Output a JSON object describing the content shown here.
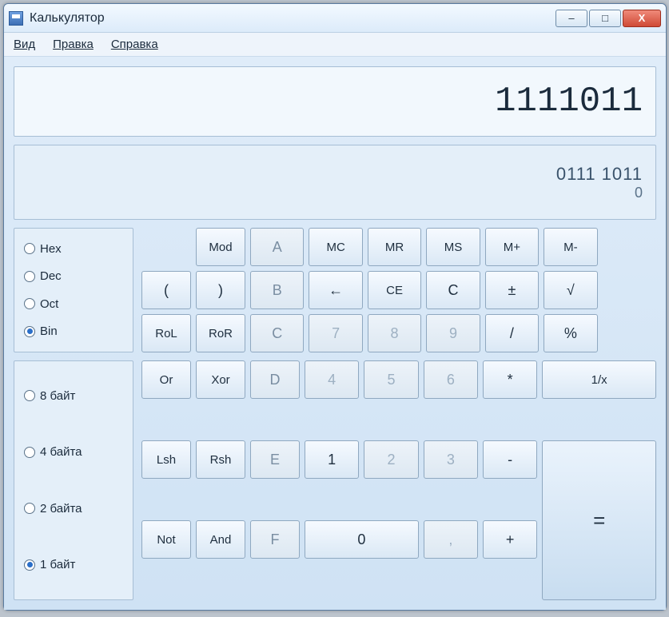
{
  "title": "Калькулятор",
  "menu": {
    "view": "Вид",
    "edit": "Правка",
    "help": "Справка"
  },
  "display": "1111011",
  "bits": {
    "row1": "0111  1011",
    "row2": "0"
  },
  "base_radios": [
    {
      "label": "Hex",
      "checked": false
    },
    {
      "label": "Dec",
      "checked": false
    },
    {
      "label": "Oct",
      "checked": false
    },
    {
      "label": "Bin",
      "checked": true
    }
  ],
  "word_radios": [
    {
      "label": "8 байт",
      "checked": false
    },
    {
      "label": "4 байта",
      "checked": false
    },
    {
      "label": "2 байта",
      "checked": false
    },
    {
      "label": "1 байт",
      "checked": true
    }
  ],
  "keys": {
    "mod": "Mod",
    "a": "A",
    "mc": "MC",
    "mr": "MR",
    "ms": "MS",
    "mplus": "M+",
    "mminus": "M-",
    "lparen": "(",
    "rparen": ")",
    "b": "B",
    "back": "←",
    "ce": "CE",
    "c": "C",
    "pm": "±",
    "sqrt": "√",
    "rol": "RoL",
    "ror": "RoR",
    "cC": "C",
    "7": "7",
    "8": "8",
    "9": "9",
    "div": "/",
    "pct": "%",
    "or": "Or",
    "xor": "Xor",
    "d": "D",
    "4": "4",
    "5": "5",
    "6": "6",
    "mul": "*",
    "inv": "1/x",
    "lsh": "Lsh",
    "rsh": "Rsh",
    "e": "E",
    "1": "1",
    "2": "2",
    "3": "3",
    "sub": "-",
    "eq": "=",
    "not": "Not",
    "and": "And",
    "f": "F",
    "0": "0",
    "dot": ",",
    "add": "+"
  },
  "win": {
    "min": "–",
    "max": "□",
    "close": "X"
  }
}
